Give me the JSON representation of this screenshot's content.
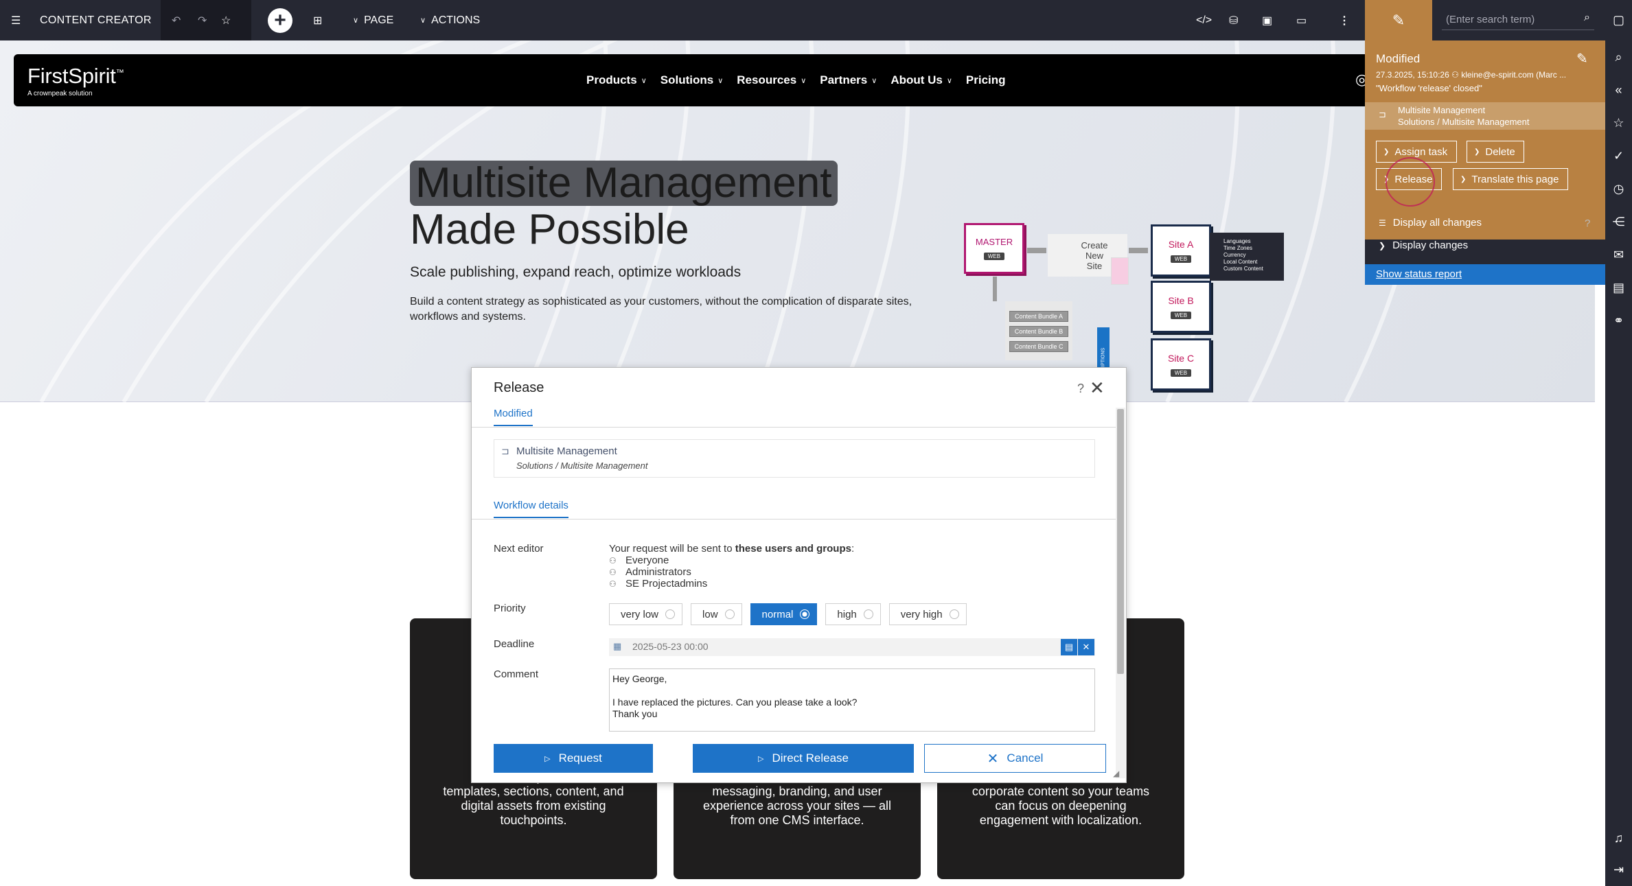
{
  "toolbar": {
    "title": "CONTENT CREATOR",
    "page_menu": "PAGE",
    "actions_menu": "ACTIONS",
    "search_placeholder": "(Enter search term)"
  },
  "site": {
    "brand": "FirstSpirit",
    "brand_tm": "™",
    "brand_sub": "A crownpeak solution",
    "nav": [
      "Products",
      "Solutions",
      "Resources",
      "Partners",
      "About Us",
      "Pricing"
    ],
    "hero_title_1": "Multisite Management",
    "hero_title_2": "Made Possible",
    "hero_sub": "Scale publishing, expand reach, optimize workloads",
    "hero_text": "Build a content strategy as sophisticated as your customers, without the complication of disparate sites, workflows and systems.",
    "diagram": {
      "master": "MASTER",
      "web": "WEB",
      "create": "Create\nNew\nSite",
      "site_a": "Site A",
      "site_b": "Site B",
      "site_c": "Site C",
      "list": [
        "Languages",
        "Time Zones",
        "Currency",
        "Local Content",
        "Custom Content"
      ],
      "bundles": [
        "Content Bundle A",
        "Content Bundle B",
        "Content Bundle C"
      ],
      "subscriptions": "SUBSCRIPTIONS"
    },
    "cards": [
      "Time... expand... templates, sections, content, and digital assets from existing touchpoints.",
      "messaging, branding, and user experience across your sites — all from one CMS interface.",
      "...inate ...corporate content so your teams can focus on deepening engagement with localization."
    ],
    "card_texts": {
      "c1": "Time\nexp\ntemplates, sections, content, and\ndigital assets from existing\ntouchpoints.",
      "c2": "\n\nmessaging, branding, and user\nexperience across your sites — all\nfrom one CMS interface.",
      "c3": "inate\n\ncorporate content so your teams\ncan focus on deepening\nengagement with localization."
    }
  },
  "dialog": {
    "title": "Release",
    "help": "?",
    "tab_modified": "Modified",
    "page_name": "Multisite Management",
    "page_path": "Solutions / Multisite Management",
    "tab_workflow": "Workflow details",
    "label_next_editor": "Next editor",
    "request_pre": "Your request will be sent to ",
    "request_bold": "these users and groups",
    "request_post": ":",
    "users": [
      "Everyone",
      "Administrators",
      "SE Projectadmins"
    ],
    "label_priority": "Priority",
    "priorities": [
      "very low",
      "low",
      "normal",
      "high",
      "very high"
    ],
    "selected_priority": "normal",
    "label_deadline": "Deadline",
    "deadline": "2025-05-23 00:00",
    "label_comment": "Comment",
    "comment": "Hey George,\n\nI have replaced the pictures. Can you please take a look?\nThank you",
    "btn_request": "Request",
    "btn_direct": "Direct Release",
    "btn_cancel": "Cancel"
  },
  "workflow_panel": {
    "status": "Modified",
    "meta": "27.3.2025, 15:10:26",
    "meta_user": "kleine@e-spirit.com (Marc ...",
    "note": "\"Workflow 'release' closed\"",
    "page_name": "Multisite Management",
    "page_path": "Solutions / Multisite Management",
    "btn_assign": "Assign task",
    "btn_delete": "Delete",
    "btn_release": "Release",
    "btn_translate": "Translate this page",
    "link_all": "Display all changes",
    "link_changes": "Display changes",
    "help": "?",
    "report": "Show status report"
  },
  "colors": {
    "toolbar": "#262833",
    "accent": "#1e73c8",
    "workflow": "#b88142",
    "highlight_circle": "#c2185b"
  },
  "icons": [
    "menu-icon",
    "undo-icon",
    "redo-icon",
    "star-icon",
    "plus-icon",
    "grid-icon",
    "code-icon",
    "database-icon",
    "images-icon",
    "devices-icon",
    "more-icon",
    "pencil-icon",
    "search-icon",
    "globe-icon"
  ]
}
